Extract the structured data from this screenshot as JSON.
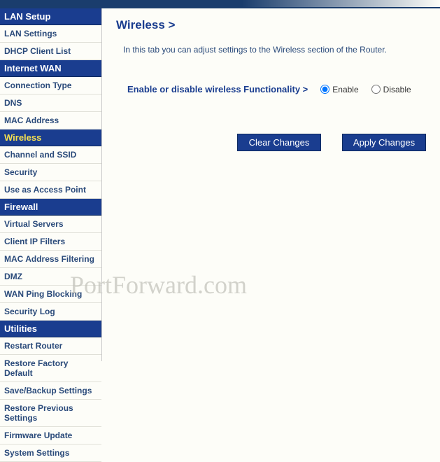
{
  "sidebar": {
    "sections": [
      {
        "header": "LAN Setup",
        "items": [
          "LAN Settings",
          "DHCP Client List"
        ]
      },
      {
        "header": "Internet WAN",
        "items": [
          "Connection Type",
          "DNS",
          "MAC Address"
        ]
      },
      {
        "header": "Wireless",
        "active": true,
        "items": [
          "Channel and SSID",
          "Security",
          "Use as Access Point"
        ]
      },
      {
        "header": "Firewall",
        "items": [
          "Virtual Servers",
          "Client IP Filters",
          "MAC Address Filtering",
          "DMZ",
          "WAN Ping Blocking",
          "Security Log"
        ]
      },
      {
        "header": "Utilities",
        "items": [
          "Restart Router",
          "Restore Factory Default",
          "Save/Backup Settings",
          "Restore Previous Settings",
          "Firmware Update",
          "System Settings"
        ]
      }
    ]
  },
  "main": {
    "breadcrumb": "Wireless >",
    "description": "In this tab you can adjust settings to the Wireless section of the Router.",
    "setting_label": "Enable or disable wireless Functionality >",
    "enable_label": "Enable",
    "disable_label": "Disable",
    "wireless_enabled": true,
    "clear_button": "Clear Changes",
    "apply_button": "Apply Changes"
  },
  "watermark": "PortForward.com"
}
